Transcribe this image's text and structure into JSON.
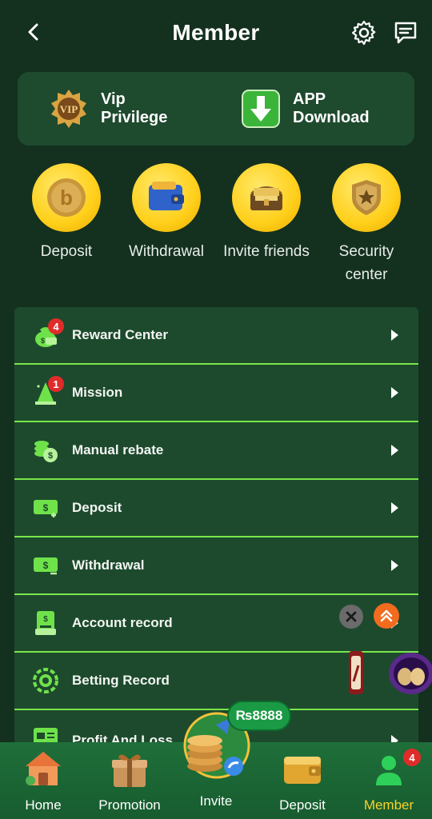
{
  "header": {
    "title": "Member"
  },
  "top_card": {
    "vip_label": "Vip\nPrivilege",
    "app_label": "APP\nDownload"
  },
  "quick_actions": [
    {
      "label": "Deposit",
      "icon": "coin-icon"
    },
    {
      "label": "Withdrawal",
      "icon": "wallet-icon"
    },
    {
      "label": "Invite friends",
      "icon": "treasure-chest-icon"
    },
    {
      "label": "Security\ncenter",
      "icon": "shield-badge-icon"
    }
  ],
  "menu": [
    {
      "label": "Reward Center",
      "icon": "money-bag-icon",
      "badge": "4"
    },
    {
      "label": "Mission",
      "icon": "mission-icon",
      "badge": "1"
    },
    {
      "label": "Manual rebate",
      "icon": "coins-stack-icon"
    },
    {
      "label": "Deposit",
      "icon": "deposit-card-icon"
    },
    {
      "label": "Withdrawal",
      "icon": "withdraw-card-icon"
    },
    {
      "label": "Account record",
      "icon": "account-record-icon"
    },
    {
      "label": "Betting Record",
      "icon": "chip-icon"
    },
    {
      "label": "Profit And Loss",
      "icon": "report-icon"
    }
  ],
  "invite_promo": {
    "text": "₨8888"
  },
  "tabbar": {
    "items": [
      {
        "label": "Home",
        "icon": "house-icon"
      },
      {
        "label": "Promotion",
        "icon": "gift-box-icon"
      },
      {
        "label": "Invite",
        "icon": "coins-invite-icon"
      },
      {
        "label": "Deposit",
        "icon": "gold-wallet-icon"
      },
      {
        "label": "Member",
        "icon": "person-icon",
        "active": true
      }
    ],
    "member_badge": "4"
  },
  "colors": {
    "background": "#14301f",
    "card": "#1e4a2e",
    "divider": "#79e64a",
    "accent_yellow": "#f7d22a",
    "badge_red": "#e02b2b"
  }
}
